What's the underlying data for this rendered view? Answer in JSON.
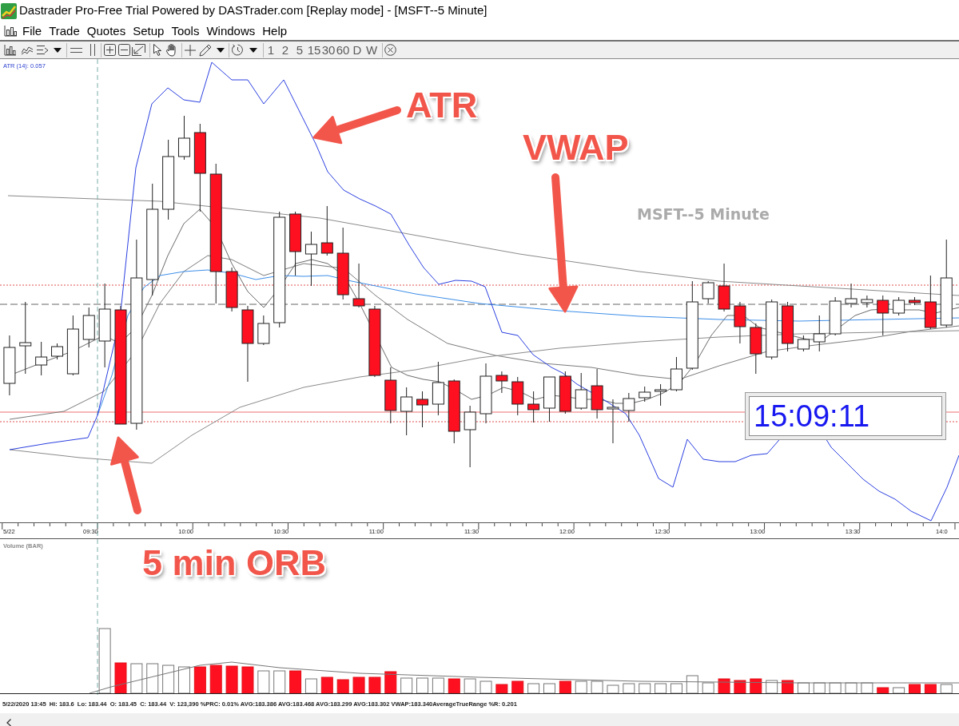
{
  "window": {
    "title": "Dastrader Pro-Free Trial Powered by DASTrader.com [Replay mode] - [MSFT--5 Minute]"
  },
  "menu": [
    "File",
    "Trade",
    "Quotes",
    "Setup",
    "Tools",
    "Windows",
    "Help"
  ],
  "toolbar": {
    "intervals": [
      "1",
      "2",
      "5",
      "15",
      "30",
      "60",
      "D",
      "W"
    ]
  },
  "price_chart": {
    "indicator_label": "ATR (14): 0.057",
    "symbol_title": "MSFT--5 Minute",
    "clock": "15:09:11"
  },
  "annotations": [
    {
      "text": "ATR"
    },
    {
      "text": "VWAP"
    },
    {
      "text": "5 min ORB"
    }
  ],
  "time_axis": {
    "labels": [
      "5/22",
      "09:30",
      "10:00",
      "10:30",
      "11:00",
      "11:30",
      "12:00",
      "12:30",
      "13:00",
      "13:30",
      "14:0"
    ]
  },
  "volume_pane": {
    "label": "Volume (BAR)"
  },
  "status_line": "5/22/2020 13:45  Hi: 183.6  Lo: 183.44  O: 183.45  C: 183.44  V: 123,390 %PRC: 0.01% AVG:183.386 AVG:183.468 AVG:183.299 AVG:183.302 VWAP:183.340AverageTrueRange %R: 0.201"
}
